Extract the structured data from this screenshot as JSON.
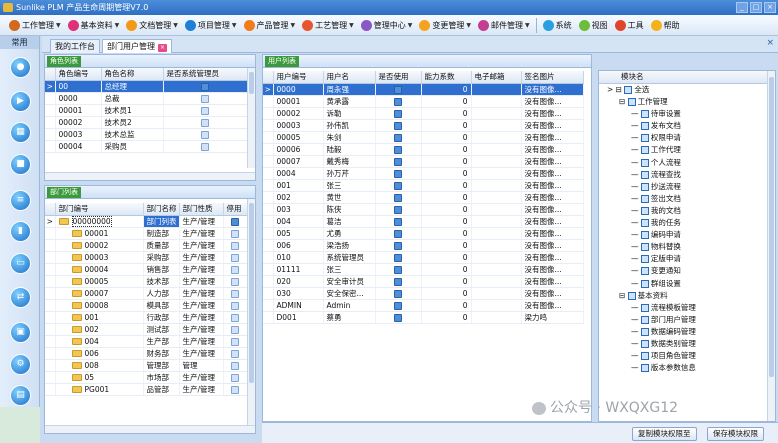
{
  "window": {
    "title": "Sunlike PLM 产品生命周期管理V7.0"
  },
  "menu": [
    {
      "label": "工作管理",
      "color": "#d2691e",
      "arrow": true
    },
    {
      "label": "基本资料",
      "color": "#e0307a",
      "arrow": true
    },
    {
      "label": "文档管理",
      "color": "#f29a17",
      "arrow": true
    },
    {
      "label": "项目管理",
      "color": "#1e7fd6",
      "arrow": true
    },
    {
      "label": "产品管理",
      "color": "#f07c1a",
      "arrow": true
    },
    {
      "label": "工艺管理",
      "color": "#e8552d",
      "arrow": true
    },
    {
      "label": "管理中心",
      "color": "#8a56c8",
      "arrow": true
    },
    {
      "label": "变更管理",
      "color": "#f4a21f",
      "arrow": true
    },
    {
      "label": "邮件管理",
      "color": "#c43d8f",
      "arrow": true
    },
    {
      "label": "系统",
      "color": "#29a1e0",
      "arrow": false
    },
    {
      "label": "视图",
      "color": "#6bbd3a",
      "arrow": false
    },
    {
      "label": "工具",
      "color": "#e0452c",
      "arrow": false
    },
    {
      "label": "帮助",
      "color": "#f5b21c",
      "arrow": false
    }
  ],
  "leftnav": {
    "header": "常用"
  },
  "tabs": [
    {
      "label": "我的工作台"
    },
    {
      "label": "部门用户管理"
    }
  ],
  "roles": {
    "title": "角色列表",
    "columns": [
      "角色编号",
      "角色名称",
      "是否系统管理员"
    ],
    "rows": [
      {
        "id": "00",
        "name": "总经理",
        "admin": true
      },
      {
        "id": "0000",
        "name": "总裁",
        "admin": false
      },
      {
        "id": "00001",
        "name": "技术员1",
        "admin": false
      },
      {
        "id": "00002",
        "name": "技术员2",
        "admin": false
      },
      {
        "id": "00003",
        "name": "技术总监",
        "admin": false
      },
      {
        "id": "00004",
        "name": "采购员",
        "admin": false
      }
    ]
  },
  "departments": {
    "title": "部门列表",
    "columns": [
      "部门编号",
      "部门名称",
      "部门性质",
      "停用"
    ],
    "rows": [
      {
        "id": "00000000",
        "name": "部门列表",
        "type": "生产/管理",
        "disabled": true,
        "level": 0
      },
      {
        "id": "00001",
        "name": "制造部",
        "type": "生产/管理",
        "disabled": false,
        "level": 1
      },
      {
        "id": "00002",
        "name": "质量部",
        "type": "生产/管理",
        "disabled": false,
        "level": 1
      },
      {
        "id": "00003",
        "name": "采购部",
        "type": "生产/管理",
        "disabled": false,
        "level": 1
      },
      {
        "id": "00004",
        "name": "销售部",
        "type": "生产/管理",
        "disabled": false,
        "level": 1
      },
      {
        "id": "00005",
        "name": "技术部",
        "type": "生产/管理",
        "disabled": false,
        "level": 1
      },
      {
        "id": "00007",
        "name": "人力部",
        "type": "生产/管理",
        "disabled": false,
        "level": 1
      },
      {
        "id": "00008",
        "name": "模具部",
        "type": "生产/管理",
        "disabled": false,
        "level": 1
      },
      {
        "id": "001",
        "name": "行政部",
        "type": "生产/管理",
        "disabled": false,
        "level": 1
      },
      {
        "id": "002",
        "name": "测试部",
        "type": "生产/管理",
        "disabled": false,
        "level": 1
      },
      {
        "id": "004",
        "name": "生产部",
        "type": "生产/管理",
        "disabled": false,
        "level": 1
      },
      {
        "id": "006",
        "name": "财务部",
        "type": "生产/管理",
        "disabled": false,
        "level": 1
      },
      {
        "id": "008",
        "name": "管理部",
        "type": "管理",
        "disabled": false,
        "level": 1
      },
      {
        "id": "05",
        "name": "市场部",
        "type": "生产/管理",
        "disabled": false,
        "level": 1
      },
      {
        "id": "PG001",
        "name": "品管部",
        "type": "生产/管理",
        "disabled": false,
        "level": 1
      }
    ]
  },
  "users": {
    "title": "用户列表",
    "columns": [
      "用户编号",
      "用户名",
      "是否使用",
      "能力系数",
      "电子邮箱",
      "签名图片"
    ],
    "rows": [
      {
        "id": "0000",
        "name": "周永强",
        "active": true,
        "coef": "0",
        "email": "",
        "sig": "没有图像..."
      },
      {
        "id": "00001",
        "name": "黄承露",
        "active": true,
        "coef": "0",
        "email": "",
        "sig": "没有图像..."
      },
      {
        "id": "00002",
        "name": "诉勒",
        "active": true,
        "coef": "0",
        "email": "",
        "sig": "没有图像..."
      },
      {
        "id": "00003",
        "name": "孙伟凯",
        "active": true,
        "coef": "0",
        "email": "",
        "sig": "没有图像..."
      },
      {
        "id": "00005",
        "name": "朱剑",
        "active": true,
        "coef": "0",
        "email": "",
        "sig": "没有图像..."
      },
      {
        "id": "00006",
        "name": "陆毅",
        "active": true,
        "coef": "0",
        "email": "",
        "sig": "没有图像..."
      },
      {
        "id": "00007",
        "name": "戴秀梅",
        "active": true,
        "coef": "0",
        "email": "",
        "sig": "没有图像..."
      },
      {
        "id": "0004",
        "name": "孙万芹",
        "active": true,
        "coef": "0",
        "email": "",
        "sig": "没有图像..."
      },
      {
        "id": "001",
        "name": "张三",
        "active": true,
        "coef": "0",
        "email": "",
        "sig": "没有图像..."
      },
      {
        "id": "002",
        "name": "黄世",
        "active": true,
        "coef": "0",
        "email": "",
        "sig": "没有图像..."
      },
      {
        "id": "003",
        "name": "陈侠",
        "active": true,
        "coef": "0",
        "email": "",
        "sig": "没有图像..."
      },
      {
        "id": "004",
        "name": "葛洁",
        "active": true,
        "coef": "0",
        "email": "",
        "sig": "没有图像..."
      },
      {
        "id": "005",
        "name": "尤勇",
        "active": true,
        "coef": "0",
        "email": "",
        "sig": "没有图像..."
      },
      {
        "id": "006",
        "name": "梁浩扬",
        "active": true,
        "coef": "0",
        "email": "",
        "sig": "没有图像..."
      },
      {
        "id": "010",
        "name": "系统管理员",
        "active": true,
        "coef": "0",
        "email": "",
        "sig": "没有图像..."
      },
      {
        "id": "01111",
        "name": "张三",
        "active": true,
        "coef": "0",
        "email": "",
        "sig": "没有图像..."
      },
      {
        "id": "020",
        "name": "安全审计员",
        "active": true,
        "coef": "0",
        "email": "",
        "sig": "没有图像..."
      },
      {
        "id": "030",
        "name": "安全保密...",
        "active": true,
        "coef": "0",
        "email": "",
        "sig": "没有图像..."
      },
      {
        "id": "ADMIN",
        "name": "Admin",
        "active": true,
        "coef": "0",
        "email": "",
        "sig": "没有图像..."
      },
      {
        "id": "D001",
        "name": "蔡勇",
        "active": true,
        "coef": "0",
        "email": "",
        "sig": "梁力鸣"
      }
    ]
  },
  "modules": {
    "column": "模块名",
    "nodes": [
      {
        "label": "全选",
        "level": 0
      },
      {
        "label": "工作管理",
        "level": 1
      },
      {
        "label": "待审设置",
        "level": 2
      },
      {
        "label": "发布文档",
        "level": 2
      },
      {
        "label": "权限申请",
        "level": 2
      },
      {
        "label": "工作代理",
        "level": 2
      },
      {
        "label": "个人流程",
        "level": 2
      },
      {
        "label": "流程查找",
        "level": 2
      },
      {
        "label": "抄送流程",
        "level": 2
      },
      {
        "label": "签出文档",
        "level": 2
      },
      {
        "label": "我的文档",
        "level": 2
      },
      {
        "label": "我的任务",
        "level": 2
      },
      {
        "label": "编码申请",
        "level": 2
      },
      {
        "label": "物料替换",
        "level": 2
      },
      {
        "label": "定版申请",
        "level": 2
      },
      {
        "label": "变更通知",
        "level": 2
      },
      {
        "label": "群组设置",
        "level": 2
      },
      {
        "label": "基本资料",
        "level": 1
      },
      {
        "label": "流程模板管理",
        "level": 2
      },
      {
        "label": "部门用户管理",
        "level": 2
      },
      {
        "label": "数据编码管理",
        "level": 2
      },
      {
        "label": "数据类别管理",
        "level": 2
      },
      {
        "label": "项目角色管理",
        "level": 2
      },
      {
        "label": "版本参数信息",
        "level": 2
      }
    ]
  },
  "buttons": {
    "copy": "复制模块权限至",
    "save": "保存模块权限"
  },
  "watermark": "公众号 · WXQXG12"
}
